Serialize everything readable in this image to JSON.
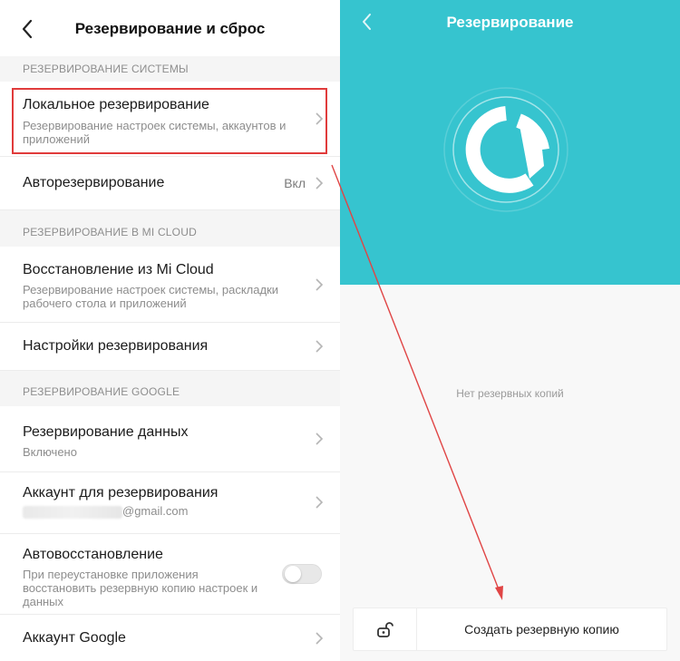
{
  "left": {
    "title": "Резервирование и сброс",
    "sections": [
      {
        "header": "РЕЗЕРВИРОВАНИЕ СИСТЕМЫ",
        "items": [
          {
            "title": "Локальное резервирование",
            "subtitle": "Резервирование настроек системы, аккаунтов и приложений"
          },
          {
            "title": "Авторезервирование",
            "value": "Вкл"
          }
        ]
      },
      {
        "header": "РЕЗЕРВИРОВАНИЕ В MI CLOUD",
        "items": [
          {
            "title": "Восстановление из Mi Cloud",
            "subtitle": "Резервирование настроек системы, раскладки рабочего стола и приложений"
          },
          {
            "title": "Настройки резервирования"
          }
        ]
      },
      {
        "header": "РЕЗЕРВИРОВАНИЕ GOOGLE",
        "items": [
          {
            "title": "Резервирование данных",
            "subtitle": "Включено"
          },
          {
            "title": "Аккаунт для резервирования",
            "email_suffix": "@gmail.com"
          },
          {
            "title": "Автовосстановление",
            "subtitle": "При переустановке приложения восстановить резервную копию настроек и данных",
            "toggle": false
          },
          {
            "title": "Аккаунт Google"
          }
        ]
      }
    ]
  },
  "right": {
    "title": "Резервирование",
    "empty_text": "Нет резервных копий",
    "create_button": "Создать резервную копию"
  },
  "colors": {
    "accent": "#36c4cf",
    "highlight": "#e03b3b",
    "arrow": "#e04545"
  },
  "icons": {
    "back": "chevron-left-icon",
    "chevron": "chevron-right-icon",
    "lock": "unlock-icon",
    "logo": "backup-logo-icon"
  }
}
